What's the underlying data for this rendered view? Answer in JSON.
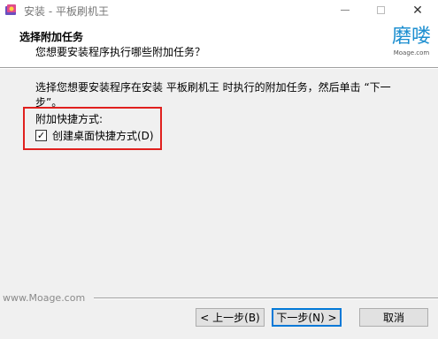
{
  "window": {
    "title": "安装 - 平板刷机王",
    "minimize_icon": "minimize-icon",
    "maximize_icon": "maximize-icon",
    "close_label": "✕"
  },
  "header": {
    "title": "选择附加任务",
    "subtitle": "您想要安装程序执行哪些附加任务？",
    "logo_cn": "磨喽",
    "logo_en": "Moage.com"
  },
  "body": {
    "description": "选择您想要安装程序在安装 平板刷机王 时执行的附加任务，然后单击 “下一步”。",
    "section_label": "附加快捷方式:",
    "checkbox_label": "创建桌面快捷方式(D)",
    "checkbox_checked": true
  },
  "watermark": "www.Moage.com",
  "buttons": {
    "back": "< 上一步(B)",
    "next": "下一步(N) >",
    "cancel": "取消"
  },
  "colors": {
    "highlight": "#e0201e",
    "logo": "#1d8fd0",
    "focus": "#0078d7"
  }
}
